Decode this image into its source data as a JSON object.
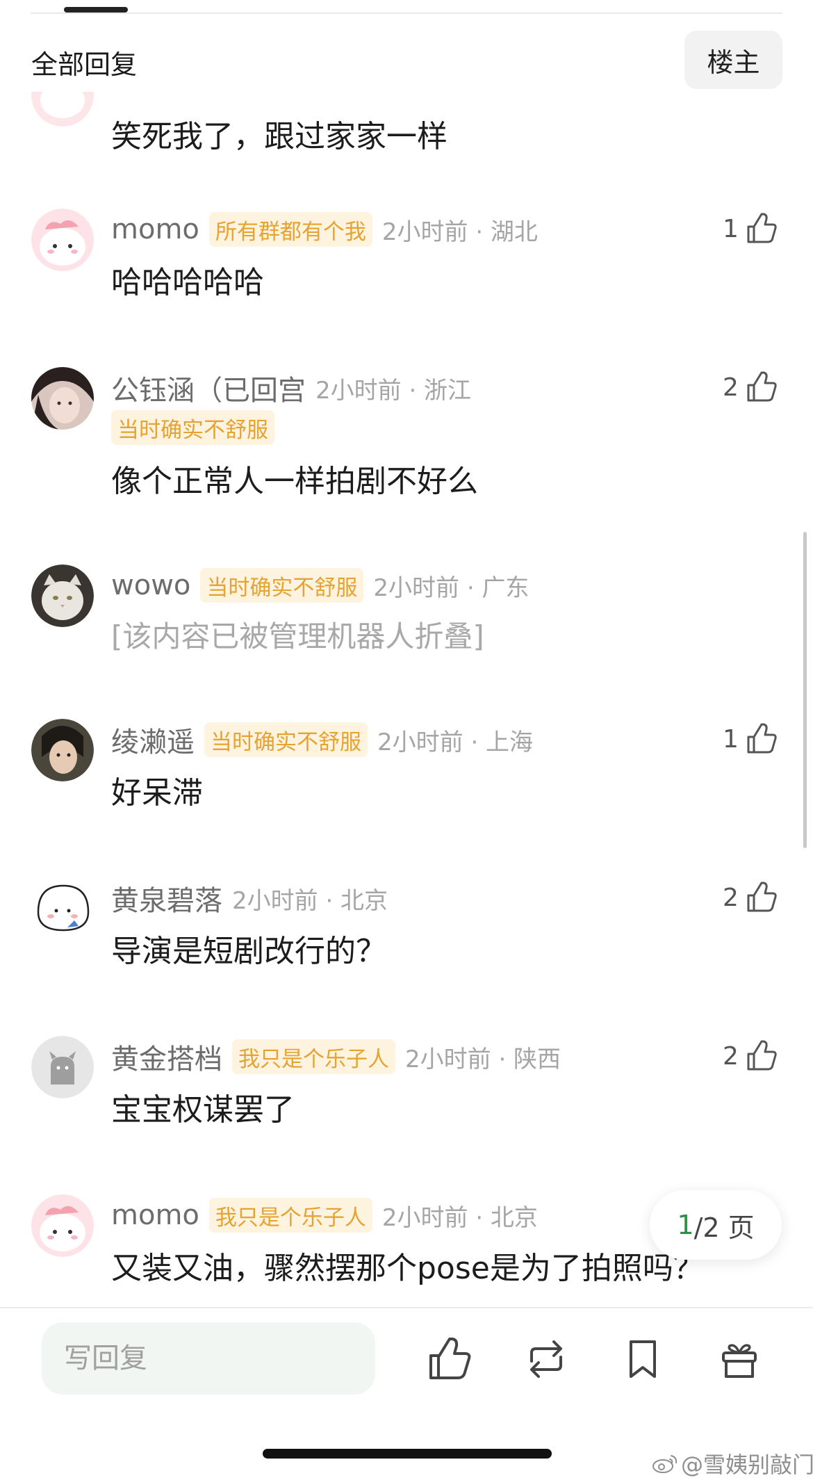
{
  "header": {
    "title": "全部回复",
    "op_button": "楼主"
  },
  "comments": [
    {
      "username": "",
      "badge": "",
      "time": "",
      "content": "笑死我了，跟过家家一样",
      "likes": "",
      "avatar": "pink-creature",
      "folded": false
    },
    {
      "username": "momo",
      "badge": "所有群都有个我",
      "time": "2小时前 · 湖北",
      "content": "哈哈哈哈哈",
      "likes": "1",
      "avatar": "pink-creature",
      "folded": false
    },
    {
      "username": "公钰涵（已回宫",
      "badge": "当时确实不舒服",
      "time": "2小时前 · 浙江",
      "content": "像个正常人一样拍剧不好么",
      "likes": "2",
      "avatar": "girl-photo",
      "folded": false
    },
    {
      "username": "wowo",
      "badge": "当时确实不舒服",
      "time": "2小时前 · 广东",
      "content": "[该内容已被管理机器人折叠]",
      "likes": "",
      "avatar": "cat-photo",
      "folded": true
    },
    {
      "username": "绫濑遥",
      "badge": "当时确实不舒服",
      "time": "2小时前 · 上海",
      "content": "好呆滞",
      "likes": "1",
      "avatar": "woman-photo",
      "folded": false
    },
    {
      "username": "黄泉碧落",
      "badge": "",
      "time": "2小时前 · 北京",
      "content": "导演是短剧改行的？",
      "likes": "2",
      "avatar": "white-blob",
      "folded": false
    },
    {
      "username": "黄金搭档",
      "badge": "我只是个乐子人",
      "time": "2小时前 · 陕西",
      "content": "宝宝权谋罢了",
      "likes": "2",
      "avatar": "default-gray",
      "folded": false
    },
    {
      "username": "momo",
      "badge": "我只是个乐子人",
      "time": "2小时前 · 北京",
      "content": "又装又油，骤然摆那个pose是为了拍照吗？",
      "likes": "",
      "avatar": "pink-creature",
      "folded": false
    }
  ],
  "pagination": {
    "current": "1",
    "rest": "/2 页"
  },
  "bottom_bar": {
    "reply_placeholder": "写回复",
    "actions": [
      "thumb-up-icon",
      "repost-icon",
      "bookmark-icon",
      "gift-icon"
    ]
  },
  "watermark": "@雪姨别敲门",
  "colors": {
    "badge_bg": "#fdf3df",
    "badge_text": "#e6a332",
    "page_current": "#2f8f46",
    "meta_gray": "#a5a5a5"
  }
}
